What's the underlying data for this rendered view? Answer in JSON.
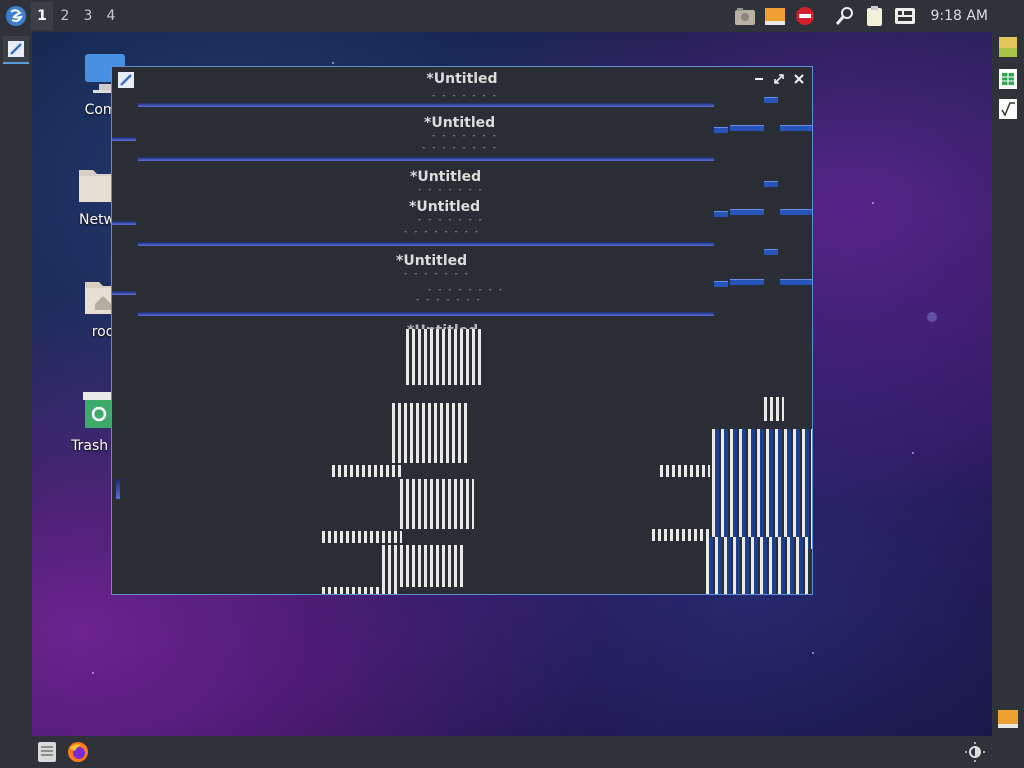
{
  "top_panel": {
    "workspaces": [
      "1",
      "2",
      "3",
      "4"
    ],
    "active_workspace": "1",
    "tray_icons": [
      "screenshot-icon",
      "drive-icon",
      "stop-icon",
      "search-tool-icon",
      "clipboard-icon",
      "keyboard-layout-icon"
    ],
    "clock": "9:18 AM"
  },
  "desktop": {
    "icons": [
      {
        "label": "Comp",
        "icon": "computer-icon"
      },
      {
        "label": "Netw",
        "icon": "network-folder-icon"
      },
      {
        "label": "roo",
        "icon": "home-folder-icon"
      },
      {
        "label": "Trash (E",
        "icon": "trash-icon"
      }
    ]
  },
  "window": {
    "title": "*Untitled",
    "ghost_titles": [
      "*Untitled",
      "*Untitled",
      "*Untitled",
      "*Untitled",
      "*Untitled"
    ]
  },
  "right_panel": {
    "icons": [
      "qt-app-icon",
      "spreadsheet-icon",
      "formula-icon",
      "drive-icon"
    ]
  },
  "bottom_panel": {
    "icons": [
      "file-manager-icon",
      "firefox-icon",
      "brightness-icon"
    ]
  },
  "colors": {
    "accent": "#5b8fd6",
    "panel": "#2f3238",
    "window_bg": "#2a2d33"
  }
}
